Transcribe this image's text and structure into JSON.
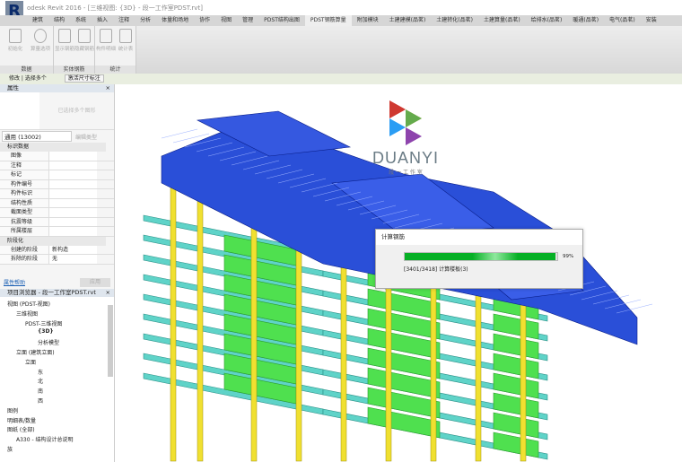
{
  "title": "odesk Revit 2016 - [三维视图: {3D} - 段一工作室PDST.rvt]",
  "tabs": [
    "建筑",
    "结构",
    "系统",
    "插入",
    "注释",
    "分析",
    "体量和场地",
    "协作",
    "视图",
    "管理",
    "PDST结构出图",
    "PDST钢筋算量",
    "附加模块",
    "土建建模(品茗)",
    "土建转化(品茗)",
    "土建算量(品茗)",
    "给排水(品茗)",
    "暖通(品茗)",
    "电气(品茗)",
    "安装"
  ],
  "active_tab": "PDST钢筋算量",
  "ribbon": {
    "panels": [
      {
        "label": "数据",
        "buttons": [
          "初始化",
          "算量选项"
        ]
      },
      {
        "label": "实体钢筋",
        "buttons": [
          "显示钢筋",
          "隐藏钢筋"
        ]
      },
      {
        "label": "统计",
        "buttons": [
          "构件明细",
          "统计表"
        ]
      }
    ]
  },
  "options_bar": {
    "context": "修改 | 选择多个",
    "button": "激活尺寸标注"
  },
  "properties": {
    "title": "属性",
    "type_preview": "已选择多个图形",
    "type_selector": "通用 (13002)",
    "edit_type": "编辑类型",
    "groups": [
      {
        "name": "标识数据",
        "rows": [
          [
            "图像",
            ""
          ],
          [
            "注释",
            ""
          ],
          [
            "标记",
            ""
          ],
          [
            "构件编号",
            ""
          ],
          [
            "构件标识",
            ""
          ],
          [
            "结构性质",
            ""
          ],
          [
            "截面类型",
            ""
          ],
          [
            "抗震等级",
            ""
          ],
          [
            "所属楼层",
            ""
          ]
        ]
      },
      {
        "name": "阶段化",
        "rows": [
          [
            "创建的阶段",
            "新构造"
          ],
          [
            "拆除的阶段",
            "无"
          ]
        ]
      }
    ],
    "help_link": "属性帮助",
    "apply": "应用"
  },
  "browser": {
    "title": "项目浏览器 - 段一工作室PDST.rvt",
    "items": [
      "视图 (PDST-视图)",
      "三维视图",
      "PDST-三维视图",
      "{3D}",
      "分析模型",
      "立面 (建筑立面)",
      "立面",
      "东",
      "北",
      "南",
      "西",
      "图例",
      "明细表/数量",
      "图纸 (全部)",
      "A330 - 结构设计总说明",
      "族"
    ]
  },
  "watermark": {
    "brand": "DUANYI",
    "sub": "段 一 工 作 室"
  },
  "dialog": {
    "title": "计算钢筋",
    "percent_label": "99%",
    "progress": 0.99,
    "status": "[3401/3418] 计算楼板(3)"
  }
}
